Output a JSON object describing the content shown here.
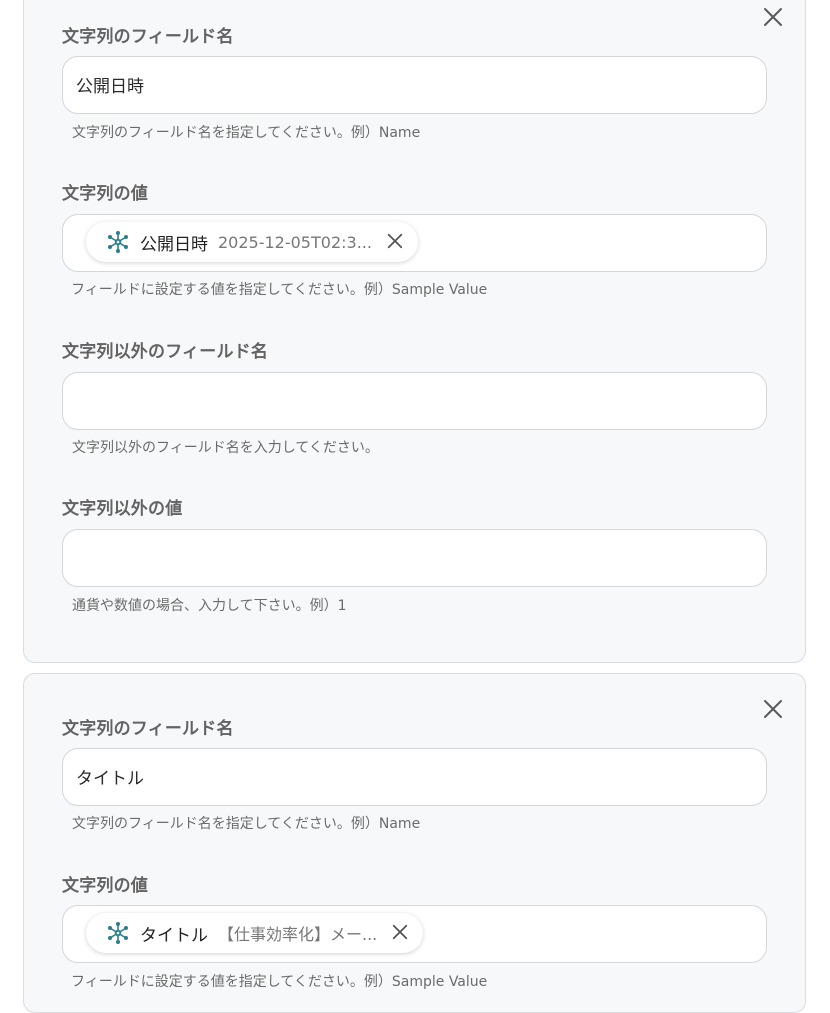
{
  "cards": [
    {
      "string_field_name": {
        "label": "文字列のフィールド名",
        "value": "公開日時",
        "help": "文字列のフィールド名を指定してください。例）Name"
      },
      "string_value": {
        "label": "文字列の値",
        "chip": {
          "icon": "network-node-icon",
          "name": "公開日時",
          "value": "2025-12-05T02:3..."
        },
        "help": "フィールドに設定する値を指定してください。例）Sample Value"
      },
      "non_string_field_name": {
        "label": "文字列以外のフィールド名",
        "value": "",
        "help": "文字列以外のフィールド名を入力してください。"
      },
      "non_string_value": {
        "label": "文字列以外の値",
        "value": "",
        "help": "通貨や数値の場合、入力して下さい。例）1"
      }
    },
    {
      "string_field_name": {
        "label": "文字列のフィールド名",
        "value": "タイトル",
        "help": "文字列のフィールド名を指定してください。例）Name"
      },
      "string_value": {
        "label": "文字列の値",
        "chip": {
          "icon": "network-node-icon",
          "name": "タイトル",
          "value": "【仕事効率化】メー..."
        },
        "help": "フィールドに設定する値を指定してください。例）Sample Value"
      }
    }
  ],
  "colors": {
    "card_bg": "#f7f8fa",
    "border": "#d3d6db",
    "label": "#636363",
    "help": "#6b6b6b",
    "icon_teal": "#2a7f8c"
  }
}
